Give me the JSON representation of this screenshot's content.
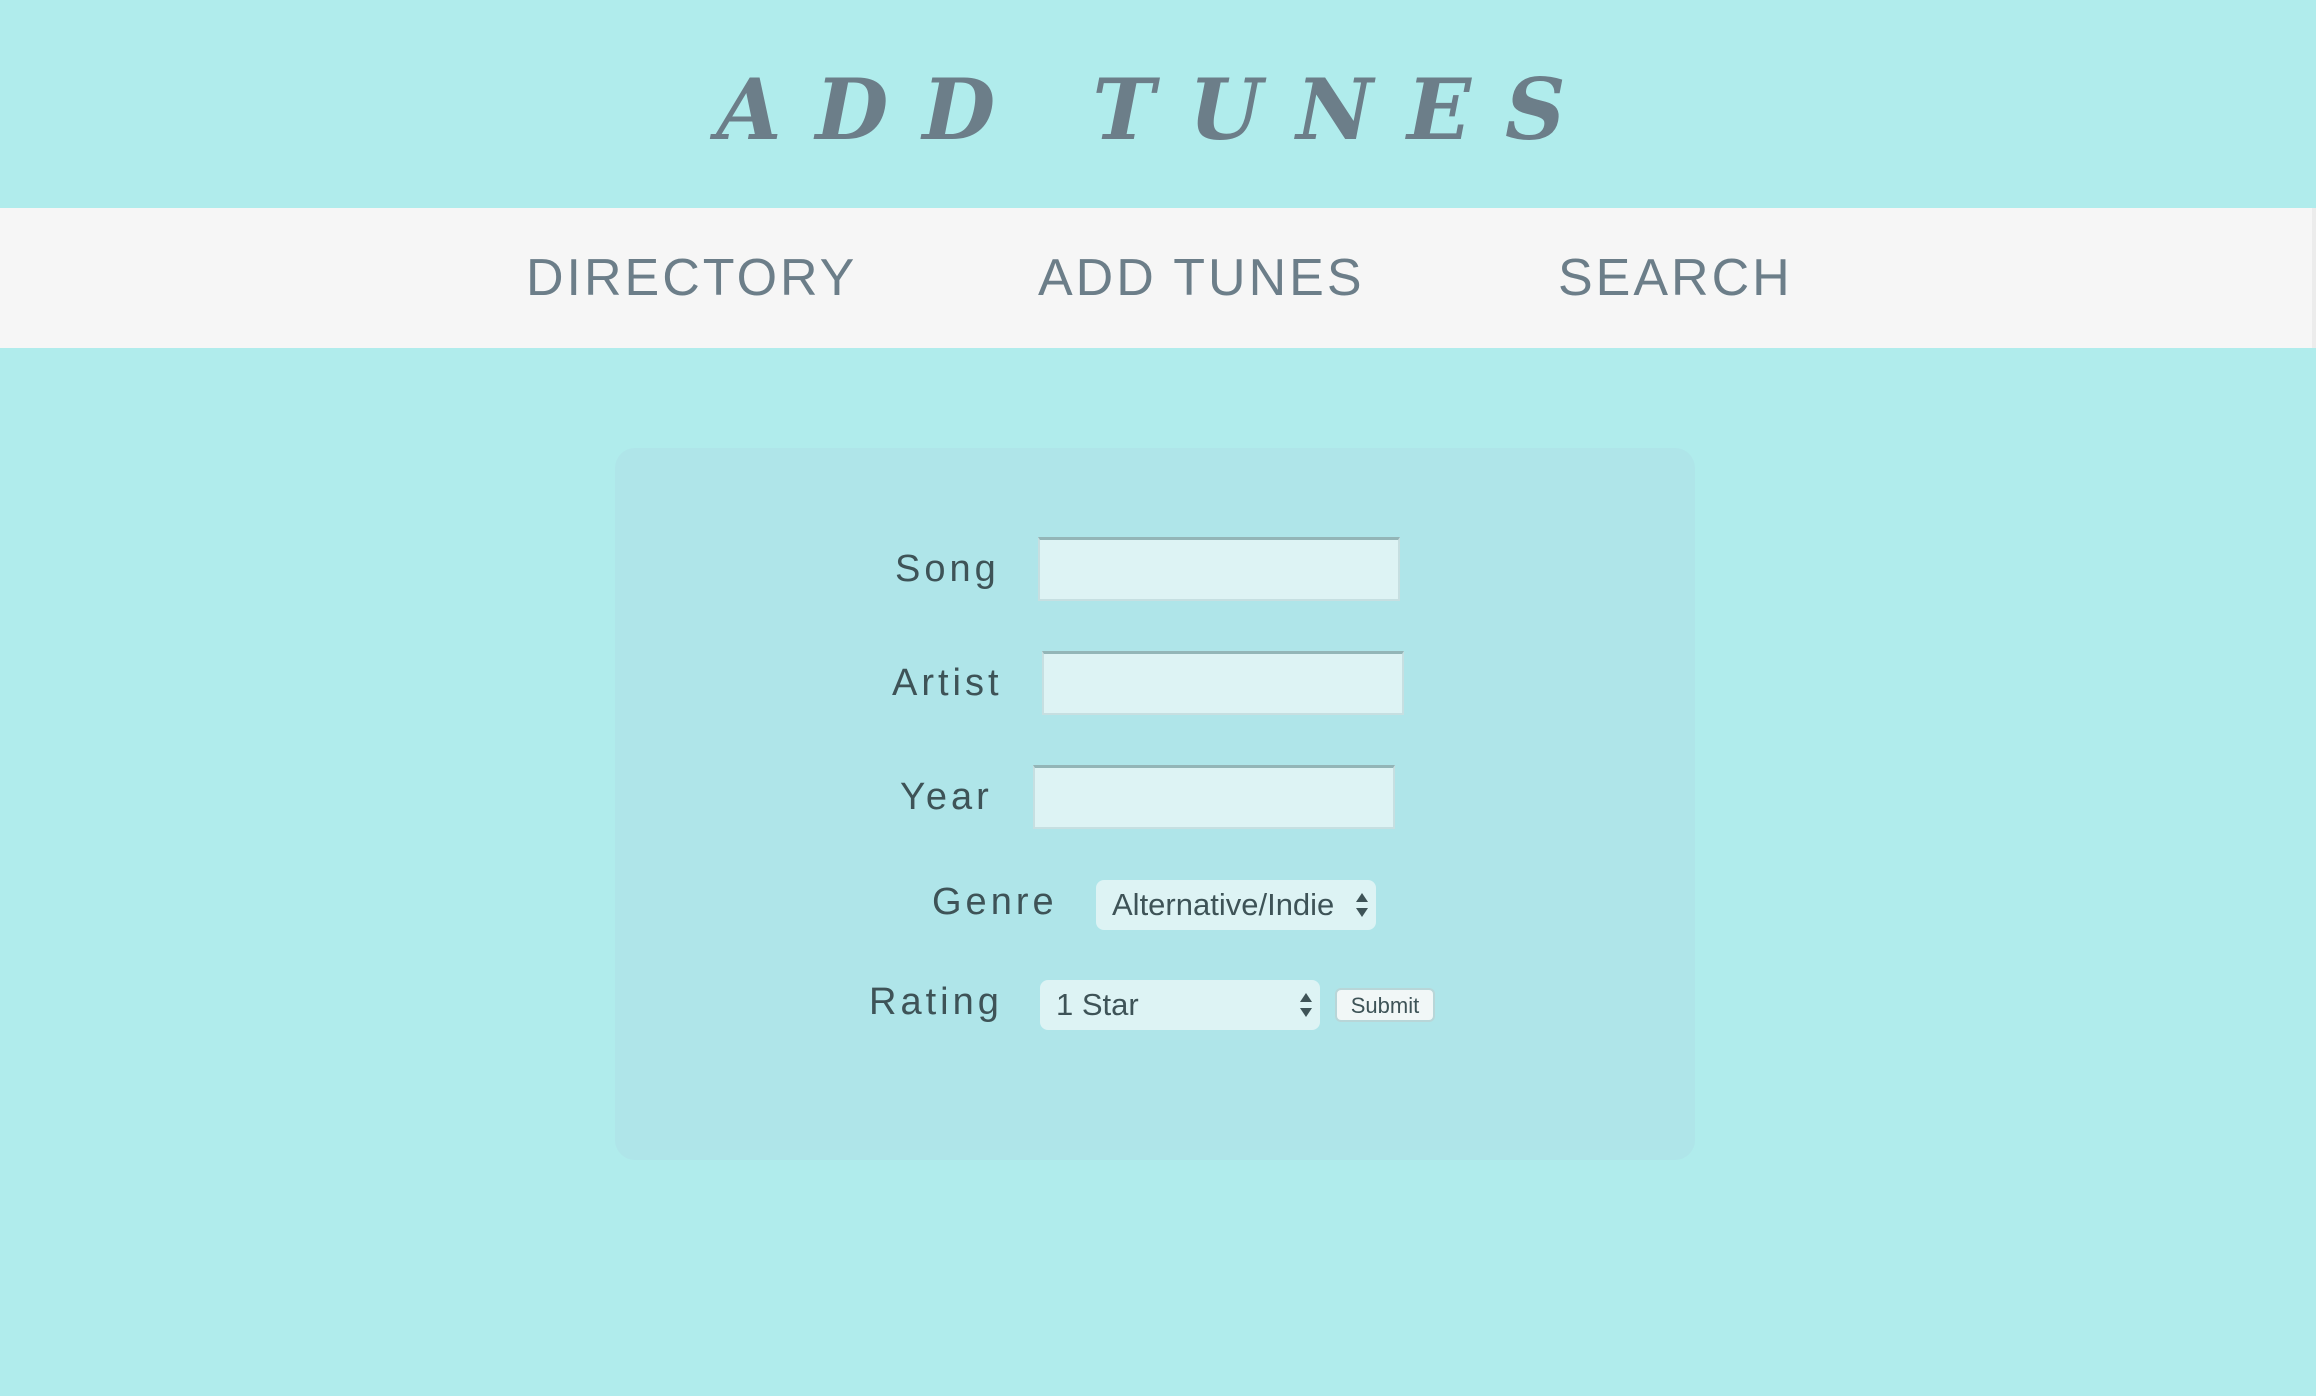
{
  "header": {
    "title": "ADD TUNES"
  },
  "nav": {
    "items": [
      {
        "label": "DIRECTORY"
      },
      {
        "label": "ADD TUNES"
      },
      {
        "label": "SEARCH"
      }
    ]
  },
  "form": {
    "song": {
      "label": "Song",
      "value": ""
    },
    "artist": {
      "label": "Artist",
      "value": ""
    },
    "year": {
      "label": "Year",
      "value": ""
    },
    "genre": {
      "label": "Genre",
      "selected": "Alternative/Indie"
    },
    "rating": {
      "label": "Rating",
      "selected": "1 Star"
    },
    "submit_label": "Submit"
  },
  "colors": {
    "background": "#b0ecec",
    "navbar": "#f6f6f6",
    "card": "#afe5e9",
    "input": "#ddf3f4",
    "accent_text": "#6c7e89",
    "label_text": "#3e5357"
  },
  "icons": {
    "select_arrows": "up-down-arrows-icon"
  }
}
